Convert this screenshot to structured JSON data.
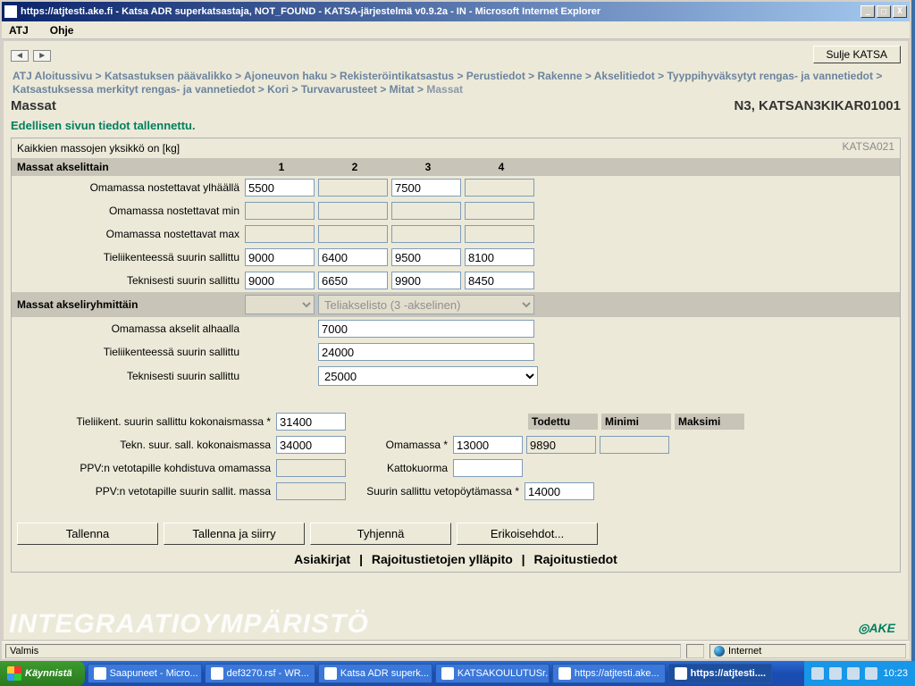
{
  "window": {
    "title": "https://atjtesti.ake.fi - Katsa ADR superkatsastaja, NOT_FOUND - KATSA-järjestelmä v0.9.2a - IN - Microsoft Internet Explorer"
  },
  "menubar": {
    "atj": "ATJ",
    "help": "Ohje"
  },
  "toolbar": {
    "close_label": "Sulje KATSA"
  },
  "breadcrumb": {
    "items": [
      "ATJ Aloitussivu",
      "Katsastuksen päävalikko",
      "Ajoneuvon haku",
      "Rekisteröintikatsastus",
      "Perustiedot",
      "Rakenne",
      "Akselitiedot",
      "Tyyppihyväksytyt rengas- ja vannetiedot",
      "Katsastuksessa merkityt rengas- ja vannetiedot",
      "Kori",
      "Turvavarusteet",
      "Mitat",
      "Massat"
    ],
    "sep": " > "
  },
  "header": {
    "title": "Massat",
    "right": "N3, KATSAN3KIKAR01001",
    "saved": "Edellisen sivun tiedot tallennettu.",
    "panel_code": "KATSA021",
    "unit_note": "Kaikkien massojen yksikkö on [kg]"
  },
  "axle": {
    "section": "Massat akselittain",
    "cols": [
      "1",
      "2",
      "3",
      "4"
    ],
    "rows": {
      "up": {
        "label": "Omamassa nostettavat ylhäällä",
        "v": [
          "5500",
          "",
          "7500",
          ""
        ],
        "ro": [
          false,
          true,
          false,
          true
        ]
      },
      "min": {
        "label": "Omamassa nostettavat min",
        "v": [
          "",
          "",
          "",
          ""
        ],
        "ro": [
          true,
          true,
          true,
          true
        ]
      },
      "max": {
        "label": "Omamassa nostettavat max",
        "v": [
          "",
          "",
          "",
          ""
        ],
        "ro": [
          true,
          true,
          true,
          true
        ]
      },
      "road": {
        "label": "Tieliikenteessä suurin sallittu",
        "v": [
          "9000",
          "6400",
          "9500",
          "8100"
        ],
        "ro": [
          false,
          false,
          false,
          false
        ]
      },
      "tech": {
        "label": "Teknisesti suurin sallittu",
        "v": [
          "9000",
          "6650",
          "9900",
          "8450"
        ],
        "ro": [
          false,
          false,
          false,
          false
        ]
      }
    }
  },
  "group": {
    "section": "Massat akseliryhmittäin",
    "combo1": "",
    "combo2": "Teliakselisto (3 -akselinen)",
    "rows": {
      "down": {
        "label": "Omamassa akselit alhaalla",
        "v": "7000"
      },
      "road": {
        "label": "Tieliikenteessä suurin sallittu",
        "v": "24000"
      },
      "tech": {
        "label": "Teknisesti suurin sallittu",
        "v": "25000"
      }
    }
  },
  "totals": {
    "road_total": {
      "label": "Tieliikent. suurin sallittu kokonaismassa *",
      "v": "31400"
    },
    "tech_total": {
      "label": "Tekn. suur. sall. kokonaismassa",
      "v": "34000"
    },
    "ppv_own": {
      "label": "PPV:n vetotapille kohdistuva omamassa",
      "v": ""
    },
    "ppv_max": {
      "label": "PPV:n vetotapille suurin sallit. massa",
      "v": ""
    },
    "towmax": {
      "label": "Suurin sallittu vetopöytämassa *",
      "v": "14000"
    },
    "headers": {
      "todettu": "Todettu",
      "min": "Minimi",
      "max": "Maksimi"
    },
    "own_label": "Omamassa *",
    "own": {
      "todettu": "13000",
      "min": "9890",
      "max": ""
    },
    "roof_label": "Kattokuorma",
    "roof": ""
  },
  "buttons": {
    "save": "Tallenna",
    "savego": "Tallenna ja siirry",
    "clear": "Tyhjennä",
    "special": "Erikoisehdot..."
  },
  "links": {
    "docs": "Asiakirjat",
    "restrict_maint": "Rajoitustietojen ylläpito",
    "restrict": "Rajoitustiedot"
  },
  "footer": {
    "env": "INTEGRAATIOYMPÄRISTÖ",
    "brand": "AKE"
  },
  "status": {
    "ready": "Valmis",
    "zone": "Internet"
  },
  "taskbar": {
    "start": "Käynnistä",
    "items": [
      {
        "t": "Saapuneet - Micro..."
      },
      {
        "t": "def3270.rsf - WR..."
      },
      {
        "t": "Katsa ADR superk..."
      },
      {
        "t": "KATSAKOULUTUSr..."
      },
      {
        "t": "https://atjtesti.ake..."
      },
      {
        "t": "https://atjtesti...."
      }
    ],
    "clock": "10:23"
  }
}
